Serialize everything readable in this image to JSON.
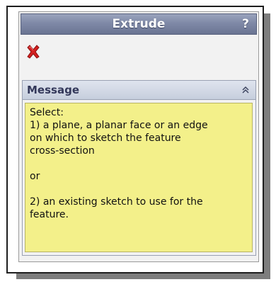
{
  "window": {
    "title": "Extrude",
    "help_label": "?"
  },
  "toolbar": {
    "cancel_icon": "red-x-icon"
  },
  "message_group": {
    "title": "Message",
    "collapse_icon": "double-chevron-up-icon",
    "lines": [
      "Select:",
      "1) a plane, a planar face or an edge",
      "on which to sketch the feature",
      "cross-section",
      "or",
      "2) an existing sketch to use for the",
      "feature."
    ]
  },
  "colors": {
    "titlebar": "#7f89a7",
    "message_background": "#f3f08a",
    "cancel_red": "#d42020"
  }
}
